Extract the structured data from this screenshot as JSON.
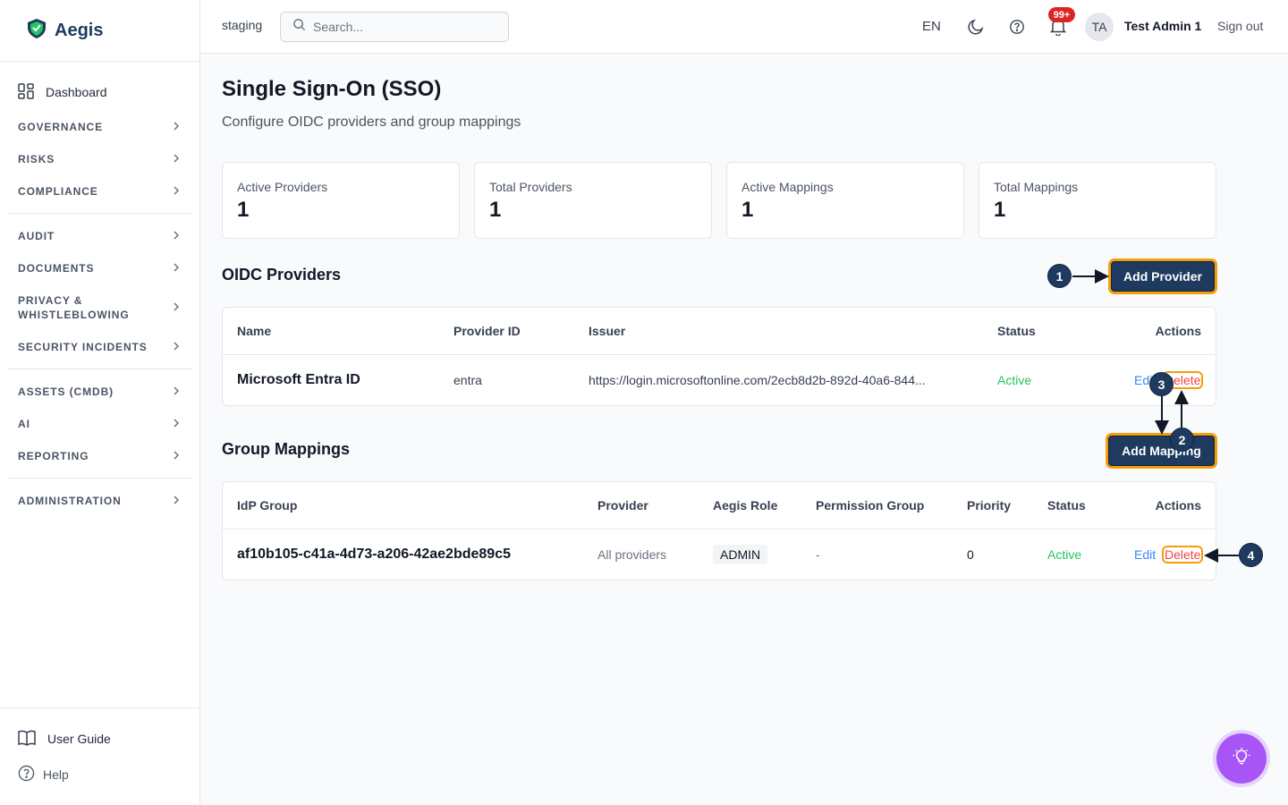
{
  "brand": {
    "name": "Aegis"
  },
  "sidebar": {
    "dashboard": "Dashboard",
    "groups": [
      [
        "GOVERNANCE",
        "RISKS",
        "COMPLIANCE"
      ],
      [
        "AUDIT",
        "DOCUMENTS",
        "PRIVACY & WHISTLEBLOWING",
        "SECURITY INCIDENTS"
      ],
      [
        "ASSETS (CMDB)",
        "AI",
        "REPORTING"
      ],
      [
        "ADMINISTRATION"
      ]
    ],
    "user_guide": "User Guide",
    "help": "Help"
  },
  "header": {
    "environment": "staging",
    "search_placeholder": "Search...",
    "language": "EN",
    "notifications_badge": "99+",
    "avatar_initials": "TA",
    "user_name": "Test Admin 1",
    "sign_out": "Sign out"
  },
  "page": {
    "title": "Single Sign-On (SSO)",
    "subtitle": "Configure OIDC providers and group mappings"
  },
  "stats": [
    {
      "label": "Active Providers",
      "value": "1"
    },
    {
      "label": "Total Providers",
      "value": "1"
    },
    {
      "label": "Active Mappings",
      "value": "1"
    },
    {
      "label": "Total Mappings",
      "value": "1"
    }
  ],
  "providers": {
    "title": "OIDC Providers",
    "add_button": "Add Provider",
    "columns": [
      "Name",
      "Provider ID",
      "Issuer",
      "Status",
      "Actions"
    ],
    "rows": [
      {
        "name": "Microsoft Entra ID",
        "provider_id": "entra",
        "issuer": "https://login.microsoftonline.com/2ecb8d2b-892d-40a6-844...",
        "status": "Active",
        "edit": "Edit",
        "delete": "Delete"
      }
    ]
  },
  "mappings": {
    "title": "Group Mappings",
    "add_button": "Add Mapping",
    "columns": [
      "IdP Group",
      "Provider",
      "Aegis Role",
      "Permission Group",
      "Priority",
      "Status",
      "Actions"
    ],
    "rows": [
      {
        "idp_group": "af10b105-c41a-4d73-a206-42ae2bde89c5",
        "provider": "All providers",
        "role": "ADMIN",
        "permission_group": "-",
        "priority": "0",
        "status": "Active",
        "edit": "Edit",
        "delete": "Delete"
      }
    ]
  },
  "annotations": [
    "1",
    "2",
    "3",
    "4"
  ],
  "colors": {
    "brand": "#1e3a5f",
    "highlight": "#f59e0b",
    "active": "#22c55e",
    "link": "#3b82f6",
    "danger": "#ef4444",
    "fab": "#a855f7"
  }
}
